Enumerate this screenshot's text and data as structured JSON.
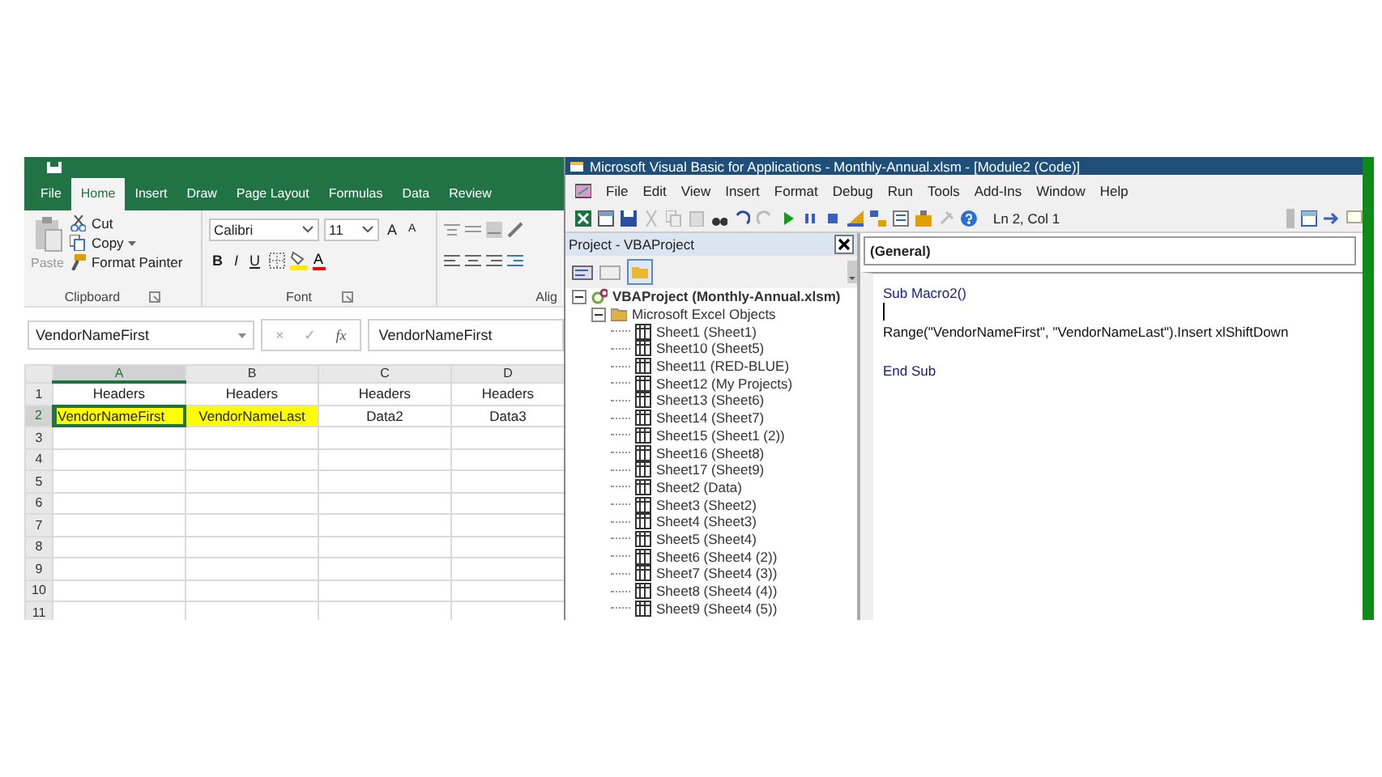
{
  "excel": {
    "tabs": [
      {
        "label": "File",
        "selected": false
      },
      {
        "label": "Home",
        "selected": true
      },
      {
        "label": "Insert",
        "selected": false
      },
      {
        "label": "Draw",
        "selected": false
      },
      {
        "label": "Page Layout",
        "selected": false
      },
      {
        "label": "Formulas",
        "selected": false
      },
      {
        "label": "Data",
        "selected": false
      },
      {
        "label": "Review",
        "selected": false
      }
    ],
    "clipboard": {
      "paste": "Paste",
      "items": [
        {
          "label": "Cut",
          "kind": "cut",
          "dropdown": false
        },
        {
          "label": "Copy",
          "kind": "copy",
          "dropdown": true
        },
        {
          "label": "Format Painter",
          "kind": "painter",
          "dropdown": false
        }
      ],
      "group": "Clipboard"
    },
    "font": {
      "name": "Calibri",
      "size": "11",
      "grow": "A",
      "shrink": "A",
      "bold": "B",
      "italic": "I",
      "underline": "U",
      "color_letter": "A",
      "group": "Font"
    },
    "alignment": {
      "group": "Alig"
    },
    "formula_bar": {
      "name_box": "VendorNameFirst",
      "cancel": "×",
      "enter": "✓",
      "fx": "fx",
      "value": "VendorNameFirst"
    },
    "grid": {
      "columns": [
        {
          "label": "A",
          "selected": true
        },
        {
          "label": "B",
          "selected": false
        },
        {
          "label": "C",
          "selected": false
        },
        {
          "label": "D",
          "selected": false
        }
      ],
      "rows": [
        {
          "header": "1",
          "selected": false,
          "cells": [
            {
              "text": "Headers",
              "highlight": false,
              "selected": false
            },
            {
              "text": "Headers",
              "highlight": false,
              "selected": false
            },
            {
              "text": "Headers",
              "highlight": false,
              "selected": false
            },
            {
              "text": "Headers",
              "highlight": false,
              "selected": false
            }
          ]
        },
        {
          "header": "2",
          "selected": true,
          "cells": [
            {
              "text": "VendorNameFirst",
              "highlight": true,
              "selected": true
            },
            {
              "text": "VendorNameLast",
              "highlight": true,
              "selected": false
            },
            {
              "text": "Data2",
              "highlight": false,
              "selected": false
            },
            {
              "text": "Data3",
              "highlight": false,
              "selected": false
            }
          ]
        },
        {
          "header": "3",
          "selected": false
        },
        {
          "header": "4",
          "selected": false
        },
        {
          "header": "5",
          "selected": false
        },
        {
          "header": "6",
          "selected": false
        },
        {
          "header": "7",
          "selected": false
        },
        {
          "header": "8",
          "selected": false
        },
        {
          "header": "9",
          "selected": false
        },
        {
          "header": "10",
          "selected": false
        },
        {
          "header": "11",
          "selected": false
        }
      ]
    }
  },
  "vba": {
    "title": "Microsoft Visual Basic for Applications - Monthly-Annual.xlsm - [Module2 (Code)]",
    "menu": [
      "File",
      "Edit",
      "View",
      "Insert",
      "Format",
      "Debug",
      "Run",
      "Tools",
      "Add-Ins",
      "Window",
      "Help"
    ],
    "status": "Ln 2, Col 1",
    "project": {
      "title": "Project - VBAProject",
      "tree": [
        {
          "label": "VBAProject (Monthly-Annual.xlsm)",
          "kind": "project",
          "expanded": true,
          "children": [
            {
              "label": "Microsoft Excel Objects",
              "kind": "folder",
              "expanded": true,
              "children": [
                {
                  "label": "Sheet1 (Sheet1)",
                  "kind": "sheet"
                },
                {
                  "label": "Sheet10 (Sheet5)",
                  "kind": "sheet"
                },
                {
                  "label": "Sheet11 (RED-BLUE)",
                  "kind": "sheet"
                },
                {
                  "label": "Sheet12 (My Projects)",
                  "kind": "sheet"
                },
                {
                  "label": "Sheet13 (Sheet6)",
                  "kind": "sheet"
                },
                {
                  "label": "Sheet14 (Sheet7)",
                  "kind": "sheet"
                },
                {
                  "label": "Sheet15 (Sheet1 (2))",
                  "kind": "sheet"
                },
                {
                  "label": "Sheet16 (Sheet8)",
                  "kind": "sheet"
                },
                {
                  "label": "Sheet17 (Sheet9)",
                  "kind": "sheet"
                },
                {
                  "label": "Sheet2 (Data)",
                  "kind": "sheet"
                },
                {
                  "label": "Sheet3 (Sheet2)",
                  "kind": "sheet"
                },
                {
                  "label": "Sheet4 (Sheet3)",
                  "kind": "sheet"
                },
                {
                  "label": "Sheet5 (Sheet4)",
                  "kind": "sheet"
                },
                {
                  "label": "Sheet6 (Sheet4 (2))",
                  "kind": "sheet"
                },
                {
                  "label": "Sheet7 (Sheet4 (3))",
                  "kind": "sheet"
                },
                {
                  "label": "Sheet8 (Sheet4 (4))",
                  "kind": "sheet"
                },
                {
                  "label": "Sheet9 (Sheet4 (5))",
                  "kind": "sheet"
                }
              ]
            }
          ]
        }
      ]
    },
    "code": {
      "object": "(General)",
      "lines": [
        {
          "kind": "keyword",
          "text": "Sub Macro2()"
        },
        {
          "kind": "cursor"
        },
        {
          "kind": "plain",
          "text": "Range(\"VendorNameFirst\", \"VendorNameLast\").Insert xlShiftDown"
        },
        {
          "kind": "blank"
        },
        {
          "kind": "keyword",
          "text": "End Sub"
        }
      ]
    }
  }
}
